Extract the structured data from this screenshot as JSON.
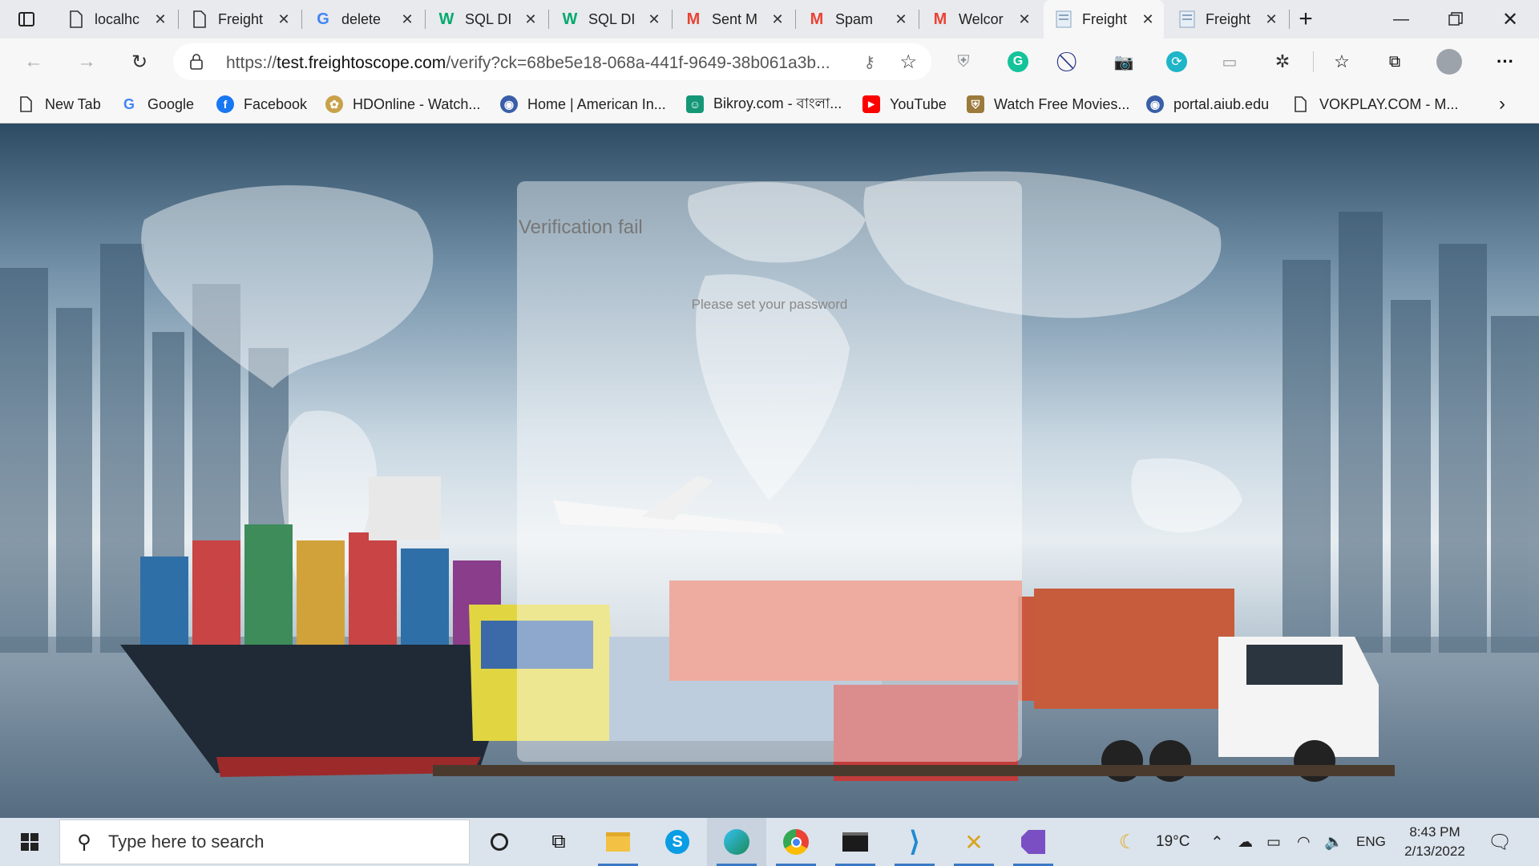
{
  "browser": {
    "tabs": [
      {
        "title": "localhc",
        "icon": "page-icon"
      },
      {
        "title": "Freight",
        "icon": "page-icon"
      },
      {
        "title": "delete",
        "icon": "google-icon"
      },
      {
        "title": "SQL DI",
        "icon": "w3schools-icon"
      },
      {
        "title": "SQL DI",
        "icon": "w3schools-icon"
      },
      {
        "title": "Sent M",
        "icon": "gmail-icon"
      },
      {
        "title": "Spam",
        "icon": "gmail-icon"
      },
      {
        "title": "Welcor",
        "icon": "gmail-icon"
      },
      {
        "title": "Freight",
        "icon": "freightoscope-icon",
        "active": true
      },
      {
        "title": "Freight",
        "icon": "freightoscope-icon"
      }
    ],
    "address": {
      "prefix": "https://",
      "domain": "test.freightoscope.com",
      "path": "/verify?ck=68be5e18-068a-441f-9649-38b061a3b..."
    },
    "bookmarks": [
      {
        "label": "New Tab",
        "icon": "page-icon"
      },
      {
        "label": "Google",
        "icon": "google-icon"
      },
      {
        "label": "Facebook",
        "icon": "facebook-icon"
      },
      {
        "label": "HDOnline - Watch...",
        "icon": "hdonline-icon"
      },
      {
        "label": "Home | American In...",
        "icon": "globe-icon"
      },
      {
        "label": "Bikroy.com - বাংলা...",
        "icon": "bikroy-icon"
      },
      {
        "label": "YouTube",
        "icon": "youtube-icon"
      },
      {
        "label": "Watch Free Movies...",
        "icon": "shield-icon"
      },
      {
        "label": "portal.aiub.edu",
        "icon": "globe-icon"
      },
      {
        "label": "VOKPLAY.COM - M...",
        "icon": "page-icon"
      }
    ]
  },
  "page": {
    "title": "Verification fail",
    "message": "Please set your password"
  },
  "taskbar": {
    "search_placeholder": "Type here to search",
    "weather": "19°C",
    "language": "ENG",
    "time": "8:43 PM",
    "date": "2/13/2022"
  },
  "colors": {
    "gmail_red": "#ea4335",
    "w3_green": "#04aa6d",
    "facebook_blue": "#1877f2",
    "youtube_red": "#ff0000",
    "taskbar_bg": "#dbe3ec"
  }
}
